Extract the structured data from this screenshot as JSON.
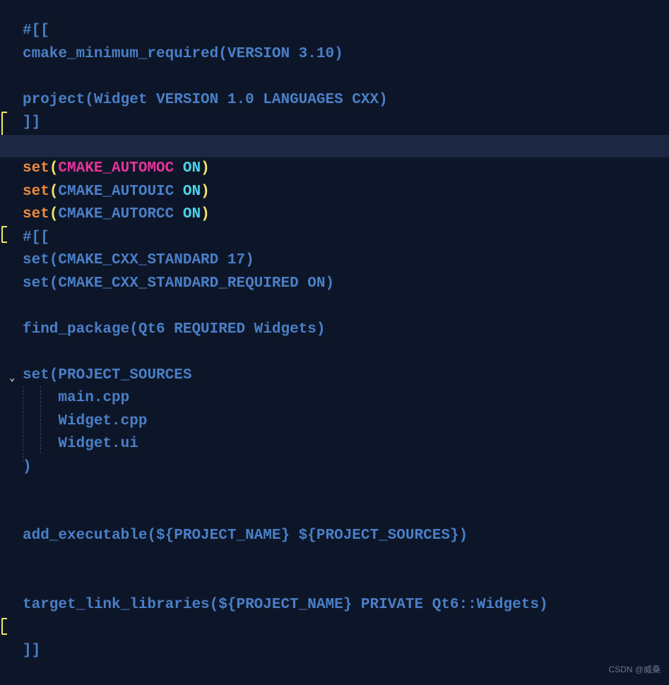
{
  "lines": {
    "l1": "#[[",
    "l2_a": "cmake_minimum_required",
    "l2_b": "(",
    "l2_c": "VERSION 3.10",
    "l2_d": ")",
    "l3": "",
    "l4_a": "project",
    "l4_b": "(",
    "l4_c": "Widget VERSION 1.0 LANGUAGES CXX",
    "l4_d": ")",
    "l5": "]]",
    "l6": "",
    "l7_a": "set",
    "l7_b": "(",
    "l7_c": "CMAKE_AUTOMOC",
    "l7_d": " ",
    "l7_e": "ON",
    "l7_f": ")",
    "l8_a": "set",
    "l8_b": "(",
    "l8_c": "CMAKE_AUTOUIC",
    "l8_d": " ",
    "l8_e": "ON",
    "l8_f": ")",
    "l9_a": "set",
    "l9_b": "(",
    "l9_c": "CMAKE_AUTORCC",
    "l9_d": " ",
    "l9_e": "ON",
    "l9_f": ")",
    "l10": "#[[",
    "l11_a": "set",
    "l11_b": "(",
    "l11_c": "CMAKE_CXX_STANDARD 17",
    "l11_d": ")",
    "l12_a": "set",
    "l12_b": "(",
    "l12_c": "CMAKE_CXX_STANDARD_REQUIRED ON",
    "l12_d": ")",
    "l13": "",
    "l14_a": "find_package",
    "l14_b": "(",
    "l14_c": "Qt6 REQUIRED Widgets",
    "l14_d": ")",
    "l15": "",
    "l16_a": "set",
    "l16_b": "(",
    "l16_c": "PROJECT_SOURCES",
    "l17": "    main.cpp",
    "l18": "    Widget.cpp",
    "l19": "    Widget.ui",
    "l20": ")",
    "l21": "",
    "l22": "",
    "l23_a": "add_executable",
    "l23_b": "(",
    "l23_c": "${PROJECT_NAME} ${PROJECT_SOURCES}",
    "l23_d": ")",
    "l24": "",
    "l25": "",
    "l26_a": "target_link_libraries",
    "l26_b": "(",
    "l26_c": "${PROJECT_NAME} PRIVATE Qt6::Widgets",
    "l26_d": ")",
    "l27": "",
    "l28": "]]"
  },
  "watermark": "CSDN @威桑"
}
